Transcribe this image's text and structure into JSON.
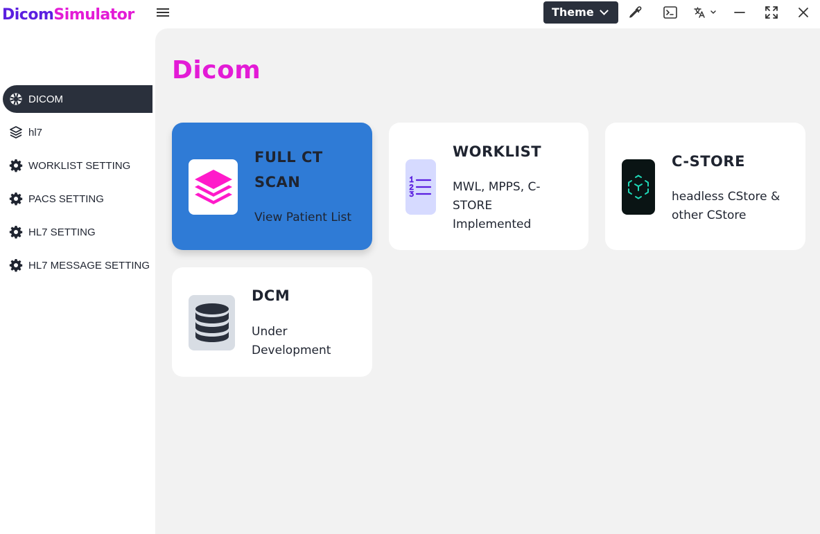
{
  "app": {
    "logo_part1": "Dicom",
    "logo_part2": "Simulator",
    "brand_purple": "#5b1fe0",
    "brand_magenta": "#e31bd6"
  },
  "titlebar": {
    "theme_label": "Theme",
    "icons": [
      "menu-icon",
      "eyedropper-icon",
      "terminal-icon",
      "translate-icon",
      "minimize-icon",
      "fullscreen-icon",
      "close-icon"
    ]
  },
  "sidebar": {
    "items": [
      {
        "label": "DICOM",
        "icon": "lifebuoy-icon",
        "active": true
      },
      {
        "label": "hl7",
        "icon": "layers-icon",
        "active": false
      },
      {
        "label": "WORKLIST SETTING",
        "icon": "gear-icon",
        "active": false
      },
      {
        "label": "PACS SETTING",
        "icon": "gear-icon",
        "active": false
      },
      {
        "label": "HL7 SETTING",
        "icon": "gear-icon",
        "active": false
      },
      {
        "label": "HL7 MESSAGE SETTING",
        "icon": "gear-icon",
        "active": false
      }
    ]
  },
  "main": {
    "title": "Dicom",
    "cards": [
      {
        "title_line1": "FULL CT",
        "title_line2": "SCAN",
        "desc": "View Patient List",
        "icon": "layers-icon",
        "accent": "#2f7bd6"
      },
      {
        "title": "WORKLIST",
        "desc_line1": "MWL, MPPS, C-",
        "desc_line2": "STORE",
        "desc_line3": "Implemented",
        "icon": "numbered-list-icon"
      },
      {
        "title": "C-STORE",
        "desc_line1": "headless CStore &",
        "desc_line2": "other CStore",
        "icon": "cube-network-icon"
      },
      {
        "title": "DCM",
        "desc_line1": "Under",
        "desc_line2": "Development",
        "icon": "database-icon"
      }
    ]
  }
}
